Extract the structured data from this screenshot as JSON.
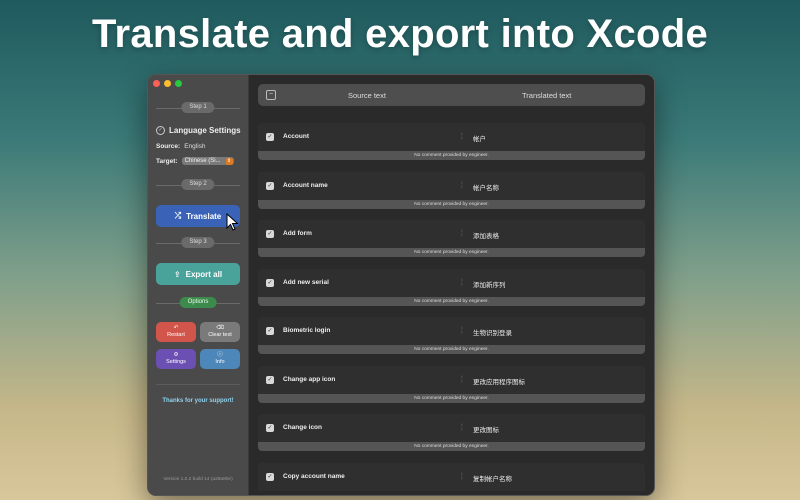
{
  "headline": "Translate and export into Xcode",
  "sidebar": {
    "step1": "Step 1",
    "language_settings": "Language Settings",
    "source_label": "Source:",
    "source_value": "English",
    "target_label": "Target:",
    "target_value": "Chinese (Si...",
    "step2": "Step 2",
    "translate_label": "Translate",
    "step3": "Step 3",
    "export_label": "Export all",
    "options": "Options",
    "restart_label": "Restart",
    "clear_label": "Clear text",
    "settings_label": "Settings",
    "info_label": "Info",
    "thanks": "Thanks for your support!",
    "version": "Version 1.0.2 build 14 (a26a80e)"
  },
  "header": {
    "source": "Source text",
    "translated": "Translated text"
  },
  "rows": [
    {
      "source": "Account",
      "target": "帐户",
      "comment": "No comment provided by engineer."
    },
    {
      "source": "Account name",
      "target": "帐户名称",
      "comment": "No comment provided by engineer."
    },
    {
      "source": "Add form",
      "target": "添加表格",
      "comment": "No comment provided by engineer."
    },
    {
      "source": "Add new serial",
      "target": "添加新序列",
      "comment": "No comment provided by engineer."
    },
    {
      "source": "Biometric login",
      "target": "生物识别登录",
      "comment": "No comment provided by engineer."
    },
    {
      "source": "Change app icon",
      "target": "更改应用程序图标",
      "comment": "No comment provided by engineer."
    },
    {
      "source": "Change icon",
      "target": "更改图标",
      "comment": "No comment provided by engineer."
    },
    {
      "source": "Copy account name",
      "target": "复制帐户名称",
      "comment": ""
    }
  ],
  "colors": {
    "translate": "#3a63b8",
    "export": "#4aa39b",
    "restart": "#d2554b",
    "settings": "#6c4fb3",
    "info": "#4d86b8",
    "options": "#3c8a4c"
  }
}
